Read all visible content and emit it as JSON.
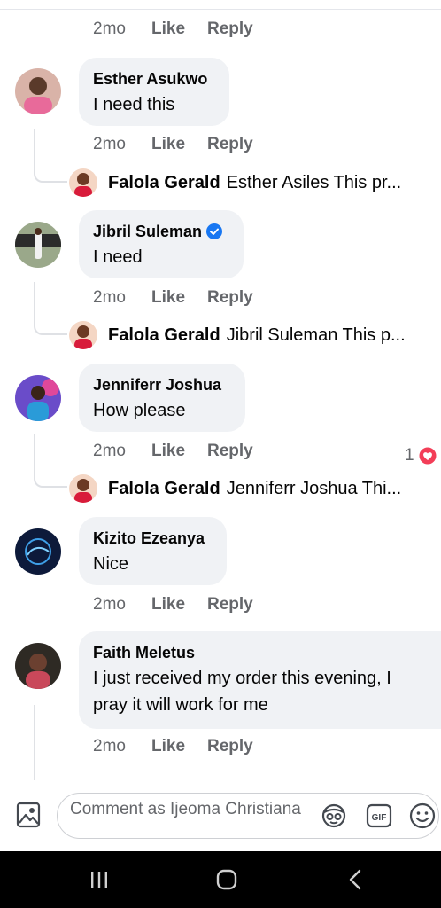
{
  "top_actions": {
    "time": "2mo",
    "like": "Like",
    "reply": "Reply"
  },
  "comments": [
    {
      "author": "Esther Asukwo",
      "text": "I need this",
      "verified": false,
      "time": "2mo",
      "like": "Like",
      "reply": "Reply",
      "reply_preview": {
        "author": "Falola Gerald",
        "text": "Esther Asiles This pr..."
      }
    },
    {
      "author": "Jibril Suleman",
      "text": "I need",
      "verified": true,
      "time": "2mo",
      "like": "Like",
      "reply": "Reply",
      "reply_preview": {
        "author": "Falola Gerald",
        "text": "Jibril Suleman This p..."
      }
    },
    {
      "author": "Jenniferr Joshua",
      "text": "How please",
      "verified": false,
      "time": "2mo",
      "like": "Like",
      "reply": "Reply",
      "reaction_count": "1",
      "reaction_icon": "heart-reaction-icon",
      "reply_preview": {
        "author": "Falola Gerald",
        "text": "Jenniferr Joshua Thi..."
      }
    },
    {
      "author": "Kizito Ezeanya",
      "text": "Nice",
      "verified": false,
      "time": "2mo",
      "like": "Like",
      "reply": "Reply"
    },
    {
      "author": "Faith Meletus",
      "text": "I just received my order this evening, I pray it will work for me",
      "verified": false,
      "time": "2mo",
      "like": "Like",
      "reply": "Reply"
    }
  ],
  "composer": {
    "placeholder": "Comment as Ijeoma Christiana",
    "icons": [
      "photo-icon",
      "avatar-sticker-icon",
      "gif-icon",
      "emoji-icon"
    ]
  },
  "system_nav": {
    "icons": [
      "recent-apps-icon",
      "home-icon",
      "back-icon"
    ]
  },
  "colors": {
    "bubble": "#f0f2f5",
    "meta": "#65676b",
    "verified": "#1877f2",
    "heart": "#f33e58"
  }
}
